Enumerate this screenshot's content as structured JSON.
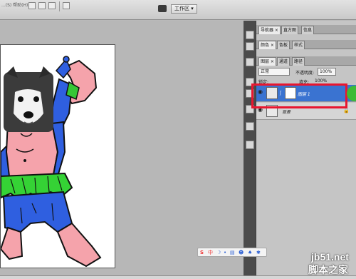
{
  "topbar": {
    "title": "...(S) 帮助(H)",
    "workspace_label": "工作区 ▾"
  },
  "panel_group_1": {
    "tabs": [
      "导航器 ×",
      "直方图",
      "信息"
    ]
  },
  "panel_group_2": {
    "tabs": [
      "颜色 ×",
      "色板",
      "样式"
    ]
  },
  "layers_panel": {
    "tabs": [
      "图层 ×",
      "通道",
      "路径"
    ],
    "blend_mode": "正常",
    "opacity_label": "不透明度:",
    "opacity_value": "100%",
    "lock_label": "锁定:",
    "fill_label": "填充:",
    "fill_value": "100%",
    "layers": [
      {
        "name": "图层 1",
        "selected": true
      },
      {
        "name": "背景",
        "selected": false
      }
    ]
  },
  "ime_bar": {
    "logo": "S",
    "lang": "中"
  },
  "watermark": {
    "line1": "jb51.net",
    "line2": "脚本之家"
  },
  "colors": {
    "highlight_border": "#e8162f",
    "selected_layer": "#3a73d1",
    "green_badge": "#3dbb35"
  }
}
